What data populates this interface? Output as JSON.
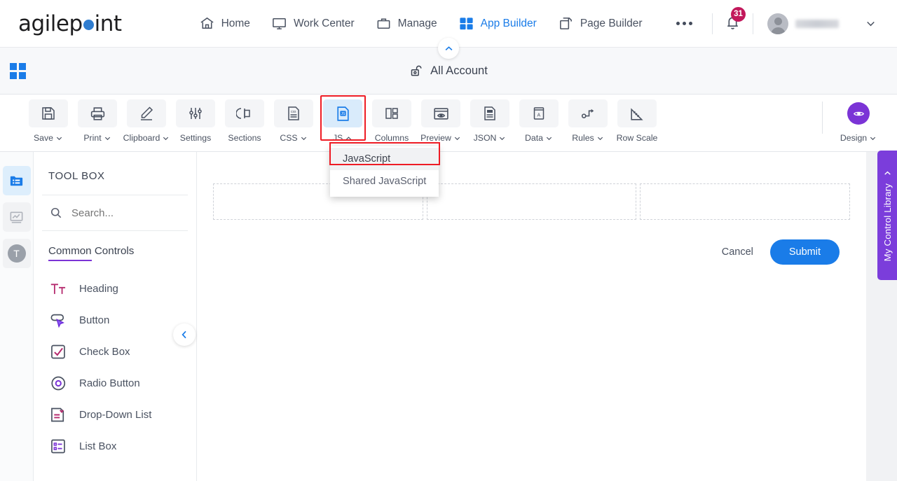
{
  "header": {
    "logo_text_1": "agilep",
    "logo_text_2": "int",
    "nav": [
      {
        "label": "Home",
        "icon": "home-icon",
        "active": false
      },
      {
        "label": "Work Center",
        "icon": "monitor-icon",
        "active": false
      },
      {
        "label": "Manage",
        "icon": "briefcase-icon",
        "active": false
      },
      {
        "label": "App Builder",
        "icon": "grid-icon",
        "active": true
      },
      {
        "label": "Page Builder",
        "icon": "copy-icon",
        "active": false
      }
    ],
    "more_icon": "ellipsis-icon",
    "notification_icon": "bell-icon",
    "notification_count": "31",
    "avatar_icon": "avatar",
    "user_name": "",
    "chevron_icon": "chevron-down-icon"
  },
  "account_bar": {
    "apps_icon": "apps-grid-icon",
    "lock_icon": "unlock-icon",
    "title": "All Account",
    "collapse_icon": "chevron-up-icon"
  },
  "toolbar": {
    "items": [
      {
        "label": "Save",
        "icon": "save-icon",
        "caret": "down",
        "selected": false
      },
      {
        "label": "Print",
        "icon": "print-icon",
        "caret": "down",
        "selected": false
      },
      {
        "label": "Clipboard",
        "icon": "pencil-icon",
        "caret": "down",
        "selected": false
      },
      {
        "label": "Settings",
        "icon": "sliders-icon",
        "caret": "none",
        "selected": false
      },
      {
        "label": "Sections",
        "icon": "sections-icon",
        "caret": "none",
        "selected": false
      },
      {
        "label": "CSS",
        "icon": "css-file-icon",
        "caret": "down",
        "selected": false
      },
      {
        "label": "JS",
        "icon": "js-file-icon",
        "caret": "up",
        "selected": true
      },
      {
        "label": "Columns",
        "icon": "columns-icon",
        "caret": "none",
        "selected": false
      },
      {
        "label": "Preview",
        "icon": "preview-eye-icon",
        "caret": "down",
        "selected": false
      },
      {
        "label": "JSON",
        "icon": "json-file-icon",
        "caret": "down",
        "selected": false
      },
      {
        "label": "Data",
        "icon": "data-book-icon",
        "caret": "down",
        "selected": false
      },
      {
        "label": "Rules",
        "icon": "rules-icon",
        "caret": "down",
        "selected": false
      },
      {
        "label": "Row Scale",
        "icon": "ruler-icon",
        "caret": "none",
        "selected": false
      }
    ],
    "design": {
      "label": "Design",
      "icon": "eye-circle-icon",
      "caret": "down",
      "color": "#7b34d6"
    }
  },
  "js_menu": {
    "items": [
      {
        "label": "JavaScript",
        "highlighted": true
      },
      {
        "label": "Shared JavaScript",
        "highlighted": false
      }
    ]
  },
  "left_rail": {
    "items": [
      {
        "icon": "folder-list-icon",
        "active": true
      },
      {
        "icon": "chart-trend-icon",
        "active": false
      },
      {
        "icon": "text-t-icon",
        "active": false
      }
    ]
  },
  "toolbox": {
    "title": "TOOL BOX",
    "search_icon": "search-icon",
    "search_placeholder": "Search...",
    "search_value": "",
    "category": "Common Controls",
    "category_accent": "#7b34d6",
    "controls": [
      {
        "label": "Heading",
        "icon": "heading-tt-icon"
      },
      {
        "label": "Button",
        "icon": "button-cursor-icon"
      },
      {
        "label": "Check Box",
        "icon": "checkbox-icon"
      },
      {
        "label": "Radio Button",
        "icon": "radio-button-icon"
      },
      {
        "label": "Drop-Down List",
        "icon": "dropdown-list-icon"
      },
      {
        "label": "List Box",
        "icon": "list-box-icon"
      }
    ],
    "collapse_icon": "chevron-left-icon"
  },
  "canvas": {
    "drop_zones": [
      "",
      "",
      ""
    ],
    "cancel_label": "Cancel",
    "submit_label": "Submit",
    "submit_color": "#1a7ce8"
  },
  "right_tab": {
    "label": "My Control Library",
    "icon": "chevron-left-icon",
    "color": "#7b3ddb"
  }
}
